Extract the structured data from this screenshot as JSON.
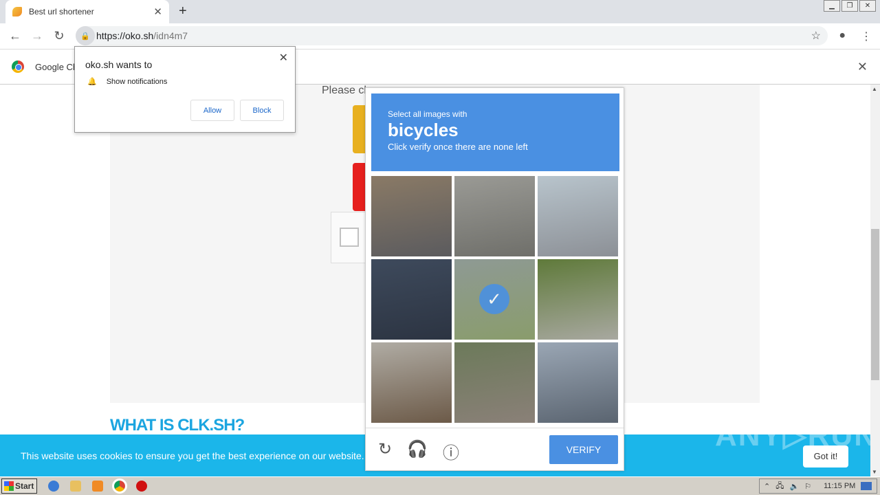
{
  "browser": {
    "tab_title": "Best url shortener",
    "url_host": "https://oko.sh",
    "url_path": "/idn4m7"
  },
  "infobar": {
    "text": "Google Ch"
  },
  "notification": {
    "title": "oko.sh wants to",
    "permission": "Show notifications",
    "allow": "Allow",
    "block": "Block"
  },
  "page": {
    "please": "Please cl",
    "what_heading": "WHAT IS CLK.SH?",
    "cookie_msg": "This website uses cookies to ensure you get the best experience on our website. Le",
    "got_it": "Got it!",
    "watermark": "ANY RUN"
  },
  "captcha": {
    "instruction": "Select all images with",
    "target": "bicycles",
    "hint": "Click verify once there are none left",
    "verify": "VERIFY",
    "tiles": [
      {
        "colors": [
          "#8a7a66",
          "#5b5b5e"
        ],
        "selected": false
      },
      {
        "colors": [
          "#9a9a95",
          "#6f6f6a"
        ],
        "selected": false
      },
      {
        "colors": [
          "#b8c4cc",
          "#8c9096"
        ],
        "selected": false
      },
      {
        "colors": [
          "#3e4a5c",
          "#2c3442"
        ],
        "selected": false
      },
      {
        "colors": [
          "#8e9a94",
          "#8a9c6c"
        ],
        "selected": true
      },
      {
        "colors": [
          "#5f7a3a",
          "#a8a8a0"
        ],
        "selected": false
      },
      {
        "colors": [
          "#b0aca4",
          "#6c5a48"
        ],
        "selected": false
      },
      {
        "colors": [
          "#6c7a5a",
          "#8a8078"
        ],
        "selected": false
      },
      {
        "colors": [
          "#9aa6b4",
          "#5a6470"
        ],
        "selected": false
      }
    ]
  },
  "taskbar": {
    "start": "Start",
    "clock": "11:15 PM"
  }
}
